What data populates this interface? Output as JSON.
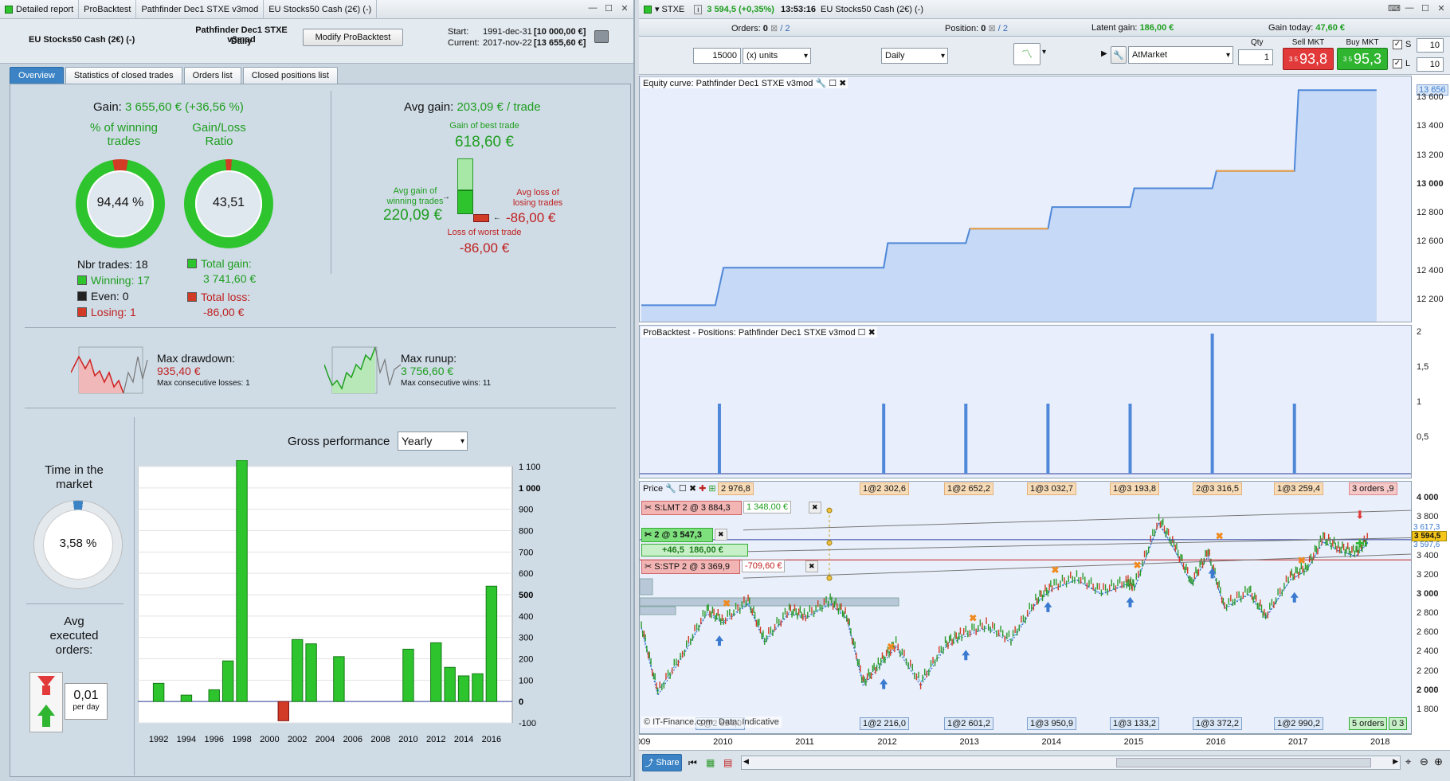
{
  "left": {
    "titlebar": {
      "tabs": [
        "Detailed report",
        "ProBacktest",
        "Pathfinder Dec1 STXE v3mod",
        "EU Stocks50 Cash (2€) (-)"
      ]
    },
    "header": {
      "instrument": "EU Stocks50 Cash (2€) (-)",
      "system": "Pathfinder Dec1 STXE v3mod",
      "timeframe": "Daily",
      "modify_label": "Modify ProBacktest",
      "start_label": "Start:",
      "start_date": "1991-dec-31",
      "start_value": "[10 000,00 €]",
      "current_label": "Current:",
      "current_date": "2017-nov-22",
      "current_value": "[13 655,60 €]"
    },
    "tabs": [
      "Overview",
      "Statistics of closed trades",
      "Orders list",
      "Closed positions list"
    ],
    "overview": {
      "gain_label": "Gain:",
      "gain_value": "3 655,60 € (+36,56 %)",
      "winning_pct_label_1": "% of winning",
      "winning_pct_label_2": "trades",
      "winning_pct_value": "94,44 %",
      "winning_pct": 94.44,
      "gl_ratio_label_1": "Gain/Loss",
      "gl_ratio_label_2": "Ratio",
      "gl_ratio_value": "43,51",
      "gl_ratio_gain_fraction": 0.9775,
      "nbr_trades": "Nbr trades: 18",
      "winning": "Winning: 17",
      "even": "Even: 0",
      "losing": "Losing: 1",
      "total_gain_label": "Total gain:",
      "total_gain_value": "3 741,60 €",
      "total_loss_label": "Total loss:",
      "total_loss_value": "-86,00 €",
      "avg_gain_label": "Avg gain:",
      "avg_gain_value": "203,09 € / trade",
      "best_trade_label": "Gain of best trade",
      "best_trade_value": "618,60 €",
      "avg_gain_win_label_1": "Avg gain of",
      "avg_gain_win_label_2": "winning trades",
      "avg_gain_win_value": "220,09 €",
      "avg_loss_label_1": "Avg loss of",
      "avg_loss_label_2": "losing trades",
      "avg_loss_value": "-86,00 €",
      "worst_trade_label": "Loss of worst trade",
      "worst_trade_value": "-86,00 €",
      "max_drawdown_label": "Max drawdown:",
      "max_drawdown_value": "935,40 €",
      "max_cons_losses": "Max consecutive losses: 1",
      "max_runup_label": "Max runup:",
      "max_runup_value": "3 756,60 €",
      "max_cons_wins": "Max consecutive wins: 11",
      "time_market_label_1": "Time in the",
      "time_market_label_2": "market",
      "time_market_value": "3,58 %",
      "time_market_pct": 3.58,
      "avg_orders_label_1": "Avg",
      "avg_orders_label_2": "executed",
      "avg_orders_label_3": "orders:",
      "avg_orders_value": "0,01",
      "avg_orders_unit": "per day",
      "gross_perf_label": "Gross performance",
      "gross_perf_select": "Yearly"
    },
    "colors": {
      "win": "#2ec42e",
      "loss": "#d23b26",
      "accent": "#3b83c4"
    }
  },
  "chart_data": [
    {
      "type": "bar",
      "title": "Gross performance",
      "x": [
        1991,
        1992,
        1993,
        1994,
        1995,
        1996,
        1997,
        1998,
        1999,
        2000,
        2001,
        2002,
        2003,
        2004,
        2005,
        2006,
        2007,
        2008,
        2009,
        2010,
        2011,
        2012,
        2013,
        2014,
        2015,
        2016,
        2017
      ],
      "values": [
        0,
        85,
        0,
        30,
        0,
        55,
        190,
        1130,
        0,
        0,
        -90,
        290,
        270,
        0,
        210,
        0,
        0,
        0,
        0,
        245,
        0,
        275,
        160,
        120,
        130,
        540,
        0
      ],
      "xticks": [
        "1992",
        "1994",
        "1996",
        "1998",
        "2000",
        "2002",
        "2004",
        "2006",
        "2008",
        "2010",
        "2012",
        "2014",
        "2016"
      ],
      "yticks": [
        "1 100",
        "1 000",
        "900",
        "800",
        "700",
        "600",
        "500",
        "400",
        "300",
        "200",
        "100",
        "0",
        "-100"
      ],
      "ylim": [
        -100,
        1100
      ]
    },
    {
      "type": "line",
      "title": "Equity curve: Pathfinder Dec1 STXE v3mod",
      "x": [
        2009.0,
        2009.9,
        2010.0,
        2011.95,
        2012.0,
        2012.95,
        2013.0,
        2013.95,
        2014.0,
        2014.95,
        2015.0,
        2015.95,
        2016.0,
        2016.95,
        2017.0,
        2017.95
      ],
      "values": [
        12170,
        12170,
        12430,
        12430,
        12600,
        12600,
        12700,
        12700,
        12850,
        12850,
        12980,
        12980,
        13100,
        13100,
        13660,
        13660
      ],
      "yticks": [
        "13 656",
        "13 600",
        "13 400",
        "13 200",
        "13 000",
        "12 800",
        "12 600",
        "12 400",
        "12 200"
      ],
      "ylim": [
        12100,
        13700
      ]
    },
    {
      "type": "bar",
      "title": "ProBacktest - Positions: Pathfinder Dec1 STXE v3mod",
      "x": [
        2009.95,
        2011.95,
        2012.95,
        2013.95,
        2014.95,
        2015.95,
        2016.95
      ],
      "values": [
        1,
        1,
        1,
        1,
        1,
        2,
        1
      ],
      "yticks": [
        "2",
        "1,5",
        "1",
        "0,5"
      ],
      "ylim": [
        0,
        2
      ]
    }
  ],
  "right": {
    "titlebar": {
      "symbol": "STXE",
      "change": "3 594,5 (+0,35%)",
      "time": "13:53:16",
      "instrument": "EU Stocks50 Cash (2€) (-)"
    },
    "toolbar1": {
      "orders_label": "Orders:",
      "orders_value": "0",
      "orders_total": "/ 2",
      "position_label": "Position:",
      "position_value": "0",
      "position_total": "/ 2",
      "latent_label": "Latent gain:",
      "latent_value": "186,00 €",
      "gain_today_label": "Gain today:",
      "gain_today_value": "47,60 €"
    },
    "toolbar2": {
      "units_value": "15000",
      "units_type": "(x) units",
      "period": "Daily",
      "order_type": "AtMarket",
      "qty_label": "Qty",
      "qty_value": "1",
      "sell_label": "Sell MKT",
      "sell_small": "3 5",
      "sell_value": "93,8",
      "buy_label": "Buy MKT",
      "buy_small": "3 5",
      "buy_value": "95,3",
      "s_label": "S",
      "s_value": "10",
      "l_label": "L",
      "l_value": "10"
    },
    "price_panel": {
      "title": "Price",
      "yticks": [
        "4 000",
        "3 800",
        "3 600",
        "3 400",
        "3 200",
        "3 000",
        "2 800",
        "2 600",
        "2 400",
        "2 200",
        "2 000",
        "1 800"
      ],
      "xticks": [
        "2009",
        "2010",
        "2011",
        "2012",
        "2013",
        "2014",
        "2015",
        "2016",
        "2017",
        "2018"
      ],
      "current_price": "3 594,5",
      "axis_tag_1": "3 617,3",
      "axis_tag_2": "3 597,6",
      "top_labels": [
        "2 976,8",
        "1@2 302,6",
        "1@2 652,2",
        "1@3 032,7",
        "1@3 193,8",
        "2@3 316,5",
        "1@3 259,4",
        "3 orders ,9"
      ],
      "bottom_labels": [
        "1@2 854,0",
        "1@2 216,0",
        "1@2 601,2",
        "1@3 950,9",
        "1@3 133,2",
        "1@3 372,2",
        "1@2 990,2",
        "5 orders",
        "0 3"
      ],
      "slmt_label": "S:LMT 2 @ 3 884,3",
      "slmt_value": "1 348,00 €",
      "pos_label": "2 @ 3 547,3",
      "pos_pts": "+46,5",
      "pos_gain": "186,00 €",
      "sstp_label": "S:STP 2 @ 3 369,9",
      "sstp_value": "-709,60 €",
      "watermark": "© IT-Finance.com",
      "source": "Data: Indicative"
    },
    "bottom": {
      "share_label": "Share"
    },
    "colors": {
      "equity_line": "#4f88d8",
      "equity_fill": "#c2d6f5",
      "gain_segment": "#f0a040",
      "bars": "#4f88d8",
      "sell": "#e23a3a",
      "buy": "#2fb52f"
    }
  }
}
